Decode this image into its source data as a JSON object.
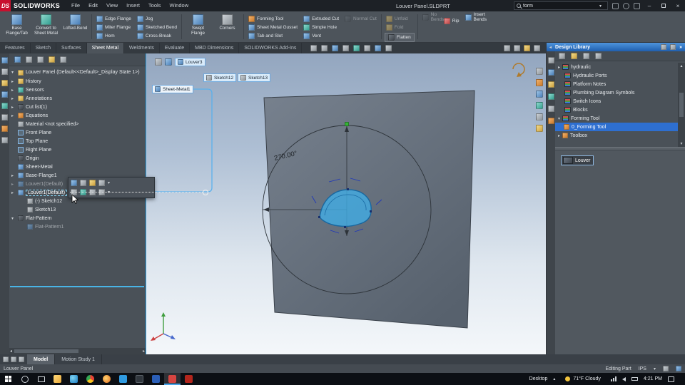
{
  "titlebar": {
    "logo_badge": "DS",
    "logo_text": "SOLIDWORKS",
    "menus": [
      "File",
      "Edit",
      "View",
      "Insert",
      "Tools",
      "Window"
    ],
    "doc_title": "Louver Panel.SLDPRT",
    "search": {
      "value": "form"
    }
  },
  "ribbon": {
    "large1": [
      "Base Flange/Tab",
      "Convert to Sheet Metal",
      "Lofted-Bend"
    ],
    "colA": [
      "Edge Flange",
      "Miter Flange",
      "Hem"
    ],
    "colB": [
      "Jog",
      "Sketched Bend",
      "Cross-Break"
    ],
    "large2": [
      "Swept Flange",
      "Corners"
    ],
    "colC": [
      "Forming Tool",
      "Sheet Metal Gusset",
      "Tab and Slot"
    ],
    "colD": [
      "Extruded Cut",
      "Simple Hole",
      "Vent"
    ],
    "colE": [
      "Normal Cut"
    ],
    "colF": [
      "Unfold",
      "Fold"
    ],
    "flatten_label": "Flatten",
    "colG": [
      "No Bends",
      "Rip",
      "Insert Bends"
    ]
  },
  "command_tabs": [
    "Features",
    "Sketch",
    "Surfaces",
    "Sheet Metal",
    "Weldments",
    "Evaluate",
    "MBD Dimensions",
    "SOLIDWORKS Add-Ins"
  ],
  "feature_tree": {
    "root": "Louver Panel (Default<<Default>_Display State 1>)",
    "items": [
      "History",
      "Sensors",
      "Annotations",
      "Cut list(1)",
      "Equations",
      "Material <not specified>",
      "Front Plane",
      "Top Plane",
      "Right Plane",
      "Origin",
      "Sheet-Metal",
      "Base-Flange1",
      "Louver1(Default)",
      "Louver1(Default)",
      "(-) Sketch12",
      "Sketch13",
      "Flat-Pattern",
      "Flat-Pattern1"
    ]
  },
  "viewport": {
    "breadcrumb_feature": "Louver3",
    "sketch_tags": [
      "Sketch12",
      "Sketch13"
    ],
    "callout": "Sheet-Metal1",
    "angle_dimension": "270.00°"
  },
  "design_library": {
    "title": "Design Library",
    "items": [
      "hydraulic",
      "Hydraulic Ports",
      "Platform Notes",
      "Plumbing Diagram Symbols",
      "Switch Icons",
      "Blocks",
      "Forming Tool",
      "0_Forming Tool",
      "Toolbox"
    ],
    "selected_item": "0_Forming Tool",
    "preview_item": "Louver"
  },
  "bottom": {
    "doc_tabs": [
      "Model",
      "Motion Study 1"
    ],
    "status_document": "Louver Panel",
    "status_mode": "Editing Part",
    "status_units": "IPS"
  },
  "taskbar": {
    "desktop_label": "Desktop",
    "weather": "71°F Cloudy",
    "time": "4:21 PM"
  },
  "colors": {
    "selection_blue": "#2e6fd0",
    "highlight_cyan": "#6fd0f2",
    "louver_fill": "#45aee8",
    "logo_red": "#c8102e",
    "library_title_blue": "#2f6fc0"
  }
}
